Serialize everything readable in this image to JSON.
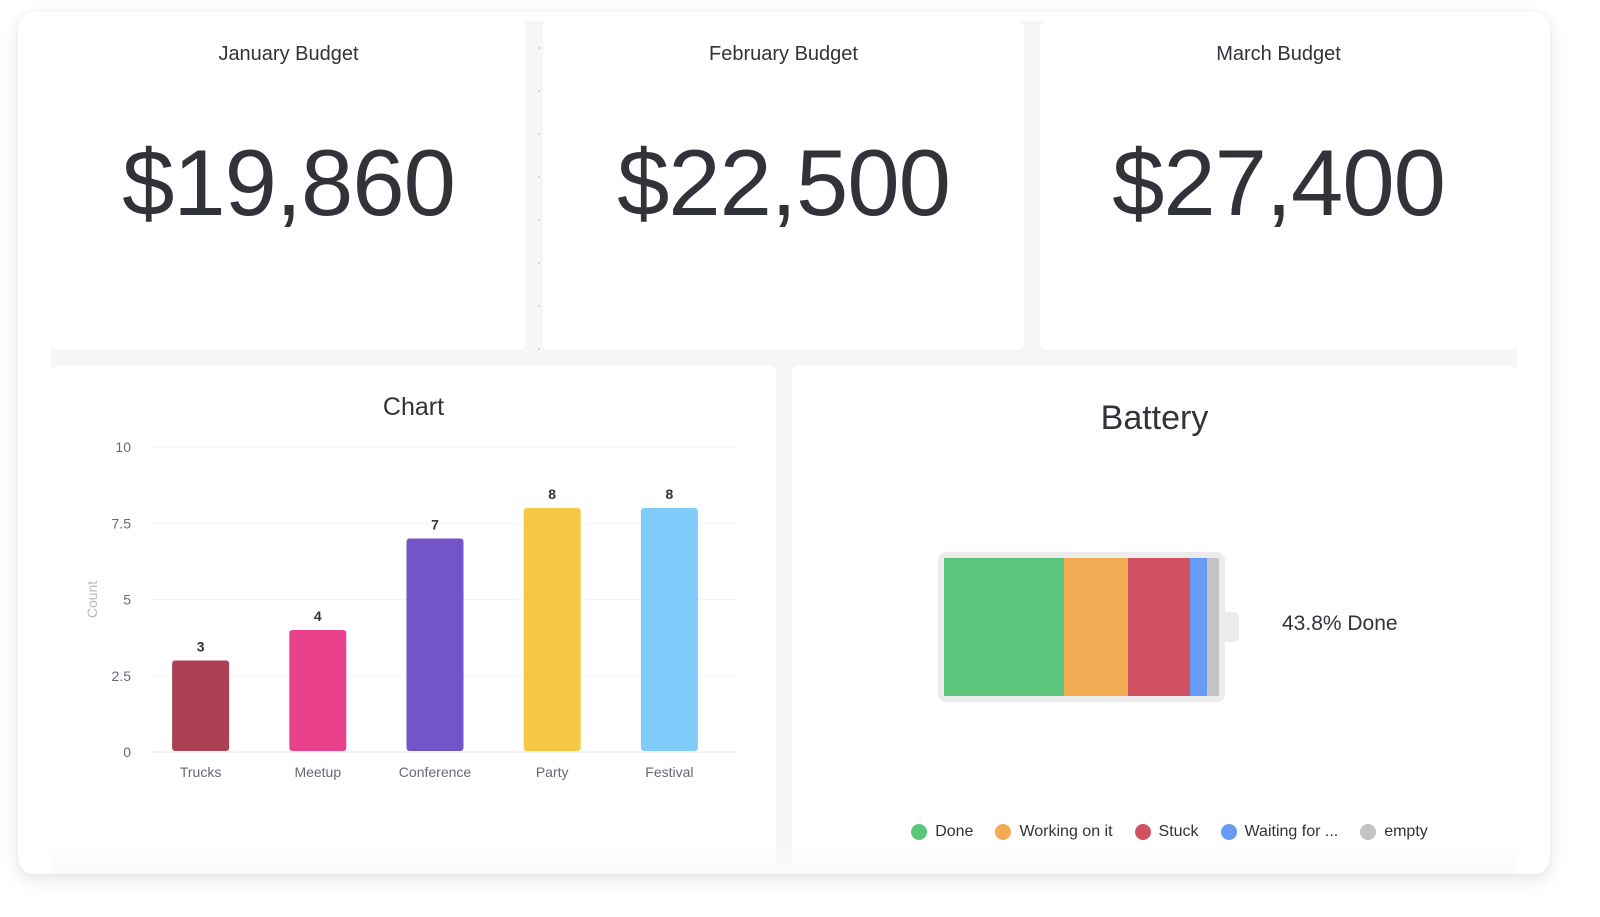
{
  "numbers": [
    {
      "title": "January Budget",
      "value": "$19,860"
    },
    {
      "title": "February Budget",
      "value": "$22,500"
    },
    {
      "title": "March Budget",
      "value": "$27,400"
    }
  ],
  "chart_data": {
    "type": "bar",
    "title": "Chart",
    "xlabel": "",
    "ylabel": "Count",
    "categories": [
      "Trucks",
      "Meetup",
      "Conference",
      "Party",
      "Festival"
    ],
    "values": [
      3,
      4,
      7,
      8,
      8
    ],
    "data_labels": [
      "3",
      "4",
      "7",
      "8",
      "8"
    ],
    "colors": [
      "#ab3f54",
      "#e9418b",
      "#7355c7",
      "#f5c945",
      "#80cbf9"
    ],
    "ylim": [
      0,
      10
    ],
    "yticks": [
      0,
      2.5,
      5,
      7.5,
      10
    ],
    "ytick_labels": [
      "0",
      "2.5",
      "5",
      "7.5",
      "10"
    ],
    "grid": true,
    "legend": "none"
  },
  "battery": {
    "title": "Battery",
    "done_label": "43.8% Done",
    "segments": [
      {
        "label": "Done",
        "percent": 43.8,
        "color": "#5bc57c"
      },
      {
        "label": "Working on it",
        "percent": 23.1,
        "color": "#f0ab53"
      },
      {
        "label": "Stuck",
        "percent": 22.4,
        "color": "#d0515f"
      },
      {
        "label": "Waiting for ...",
        "percent": 6.5,
        "color": "#669cf5"
      },
      {
        "label": "empty",
        "percent": 4.2,
        "color": "#c4c4c4"
      }
    ]
  }
}
